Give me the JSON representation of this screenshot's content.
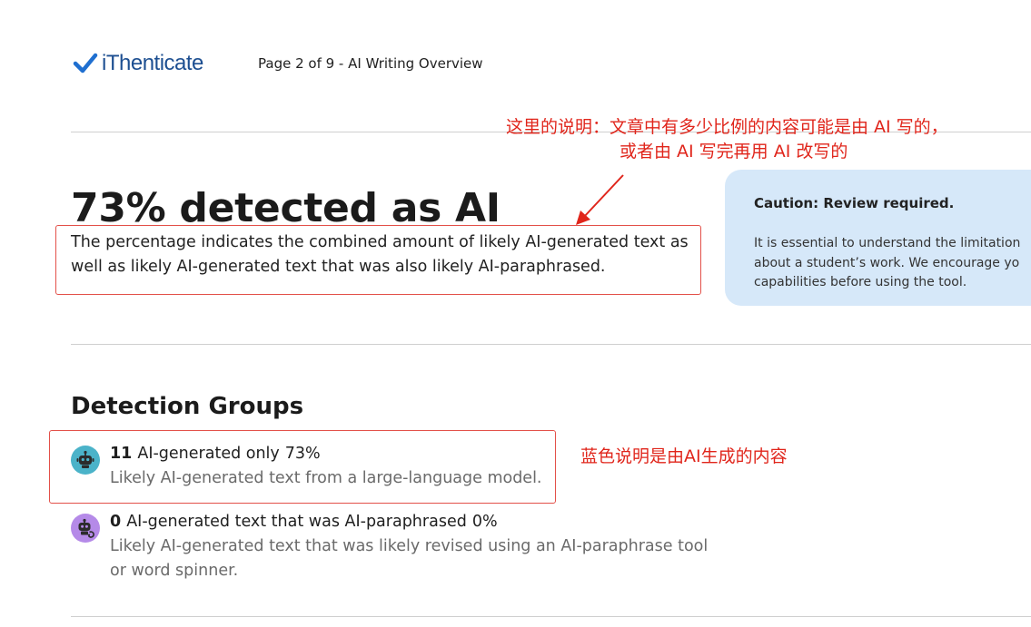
{
  "header": {
    "logo_text": "iThenticate",
    "page_info": "Page 2 of 9 - AI Writing Overview"
  },
  "annotations": {
    "top_line1": "这里的说明：文章中有多少比例的内容可能是由 AI 写的，",
    "top_line2": "或者由 AI 写完再用 AI 改写的",
    "groups_note": "蓝色说明是由AI生成的内容"
  },
  "summary": {
    "headline": "73% detected as AI",
    "description": "The percentage indicates the combined amount of likely AI-generated text as well as likely AI-generated text that was also likely AI-paraphrased."
  },
  "caution": {
    "title": "Caution: Review required.",
    "body_line1": "It is essential to understand the limitation",
    "body_line2": "about a student’s work. We encourage yo",
    "body_line3": "capabilities before using the tool."
  },
  "detection": {
    "title": "Detection Groups",
    "groups": [
      {
        "count": "11",
        "label": "AI-generated only",
        "percent": "73%",
        "description": "Likely AI-generated text from a large-language model.",
        "icon": "robot-icon",
        "color": "#4bb3c9"
      },
      {
        "count": "0",
        "label": "AI-generated text that was AI-paraphrased",
        "percent": "0%",
        "description": "Likely AI-generated text that was likely revised using an AI-paraphrase tool or word spinner.",
        "icon": "robot-paraphrase-icon",
        "color": "#b58ae8"
      }
    ]
  },
  "colors": {
    "brand": "#1d4f91",
    "annotation_red": "#e0251b",
    "caution_bg": "#d6e8f9"
  }
}
